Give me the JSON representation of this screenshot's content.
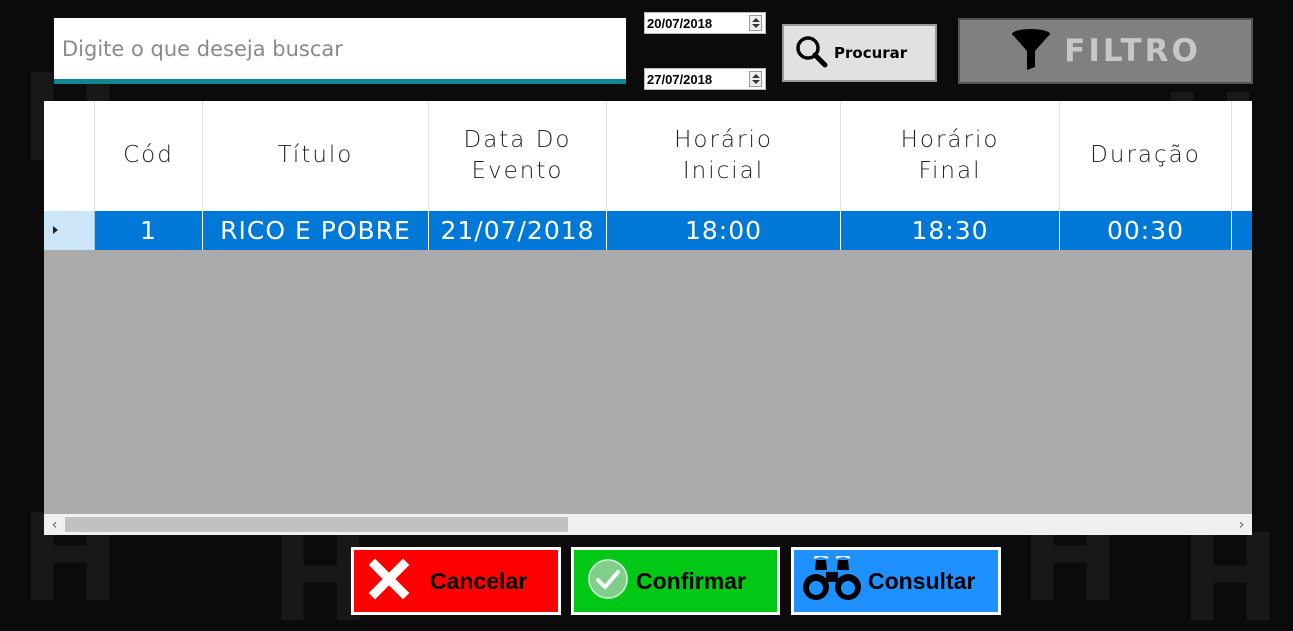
{
  "search": {
    "placeholder": "Digite o que deseja buscar",
    "value": ""
  },
  "date_start": "20/07/2018",
  "date_end": "27/07/2018",
  "toolbar": {
    "search_label": "Procurar",
    "filter_label": "FILTRO"
  },
  "grid": {
    "columns": [
      "Cód",
      "Título",
      "Data Do\nEvento",
      "Horário\nInicial",
      "Horário\nFinal",
      "Duração"
    ],
    "rows": [
      {
        "cod": "1",
        "titulo": "RICO E POBRE",
        "data": "21/07/2018",
        "inicio": "18:00",
        "fim": "18:30",
        "duracao": "00:30"
      }
    ]
  },
  "actions": {
    "cancel_label": "Cancelar",
    "confirm_label": "Confirmar",
    "consult_label": "Consultar"
  },
  "colors": {
    "accent": "#12868f",
    "selection": "#0078d7",
    "cancel": "#ff0000",
    "confirm": "#00c814",
    "consult": "#1e90ff"
  },
  "icons": [
    "search-icon",
    "filter-icon",
    "close-icon",
    "check-icon",
    "binoculars-icon",
    "row-indicator-icon",
    "scroll-left-icon",
    "scroll-right-icon"
  ]
}
